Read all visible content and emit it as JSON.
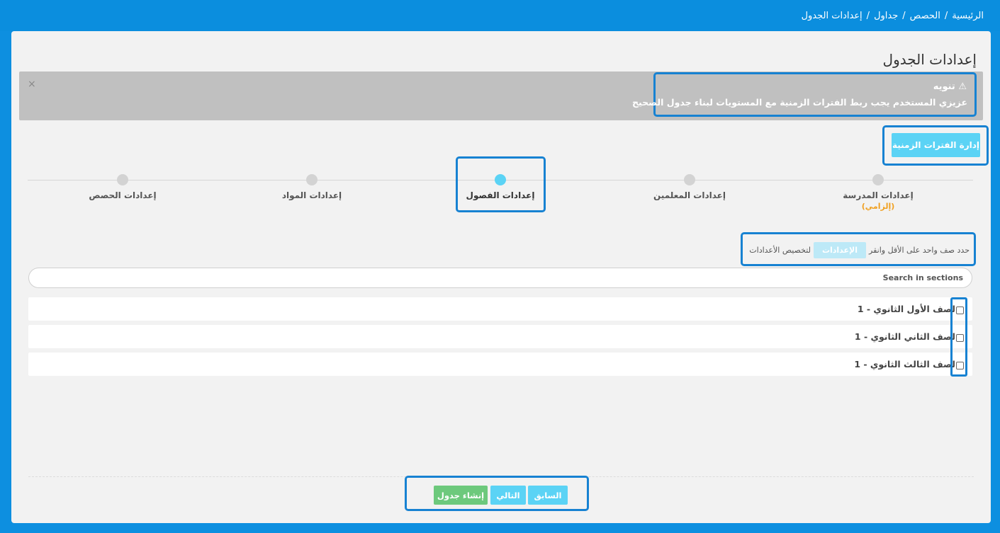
{
  "breadcrumb": {
    "home": "الرئيسية",
    "sep": "/",
    "classes": "الحصص",
    "tables": "جداول",
    "current": "إعدادات الجدول"
  },
  "page": {
    "title": "إعدادات الجدول"
  },
  "alert": {
    "icon": "warning-icon",
    "title": "تنويه",
    "text": "عزيزي المستخدم يجب ربط الفترات الزمنية مع المستويات لبناء جدول الصحيح",
    "close": "×"
  },
  "manage_button": "إدارة الفترات الزمنية",
  "steps": [
    {
      "label": "إعدادات المدرسة",
      "sub": "(إلزامي)",
      "active": false
    },
    {
      "label": "إعدادات المعلمين",
      "active": false
    },
    {
      "label": "إعدادات الفصول",
      "active": true
    },
    {
      "label": "إعدادات المواد",
      "active": false
    },
    {
      "label": "إعدادات الحصص",
      "active": false
    }
  ],
  "instruction": {
    "before": "حدد صف واحد على الأقل وانقر",
    "chip": "الإعدادات",
    "after": "لتخصيص الأعدادات"
  },
  "search": {
    "placeholder": "Search in sections"
  },
  "sections": [
    {
      "label": "لصف الأول الثانوي - 1"
    },
    {
      "label": "لصف الثاني الثانوي - 1"
    },
    {
      "label": "لصف الثالث الثانوي - 1"
    }
  ],
  "footer": {
    "prev": "السابق",
    "next": "التالي",
    "create": "إنشاء جدول"
  },
  "colors": {
    "accent": "#5bd3f5",
    "success": "#6dc97c",
    "highlight": "#1782d2",
    "header": "#0b8ede"
  }
}
